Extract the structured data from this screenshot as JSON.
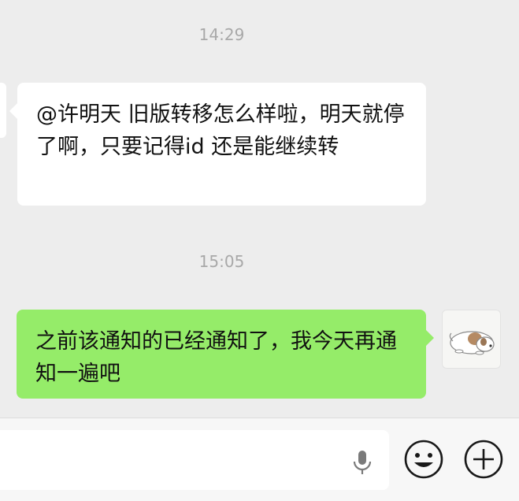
{
  "chat": {
    "timestamps": [
      "14:29",
      "15:05"
    ],
    "messages": [
      {
        "direction": "incoming",
        "text": "@许明天  旧版转移怎么样啦，明天就停了啊，只要记得id 还是能继续转"
      },
      {
        "direction": "outgoing",
        "text": "之前该通知的已经通知了，我今天再通知一遍吧"
      }
    ]
  },
  "colors": {
    "chat_background": "#ededed",
    "incoming_bubble": "#ffffff",
    "outgoing_bubble": "#95ec69",
    "timestamp_text": "#a8a8a8",
    "input_bar": "#f7f7f7"
  },
  "icons": {
    "avatar": "dog-avatar",
    "voice": "microphone-icon",
    "emoji": "smiley-icon",
    "more": "plus-circle-icon"
  }
}
